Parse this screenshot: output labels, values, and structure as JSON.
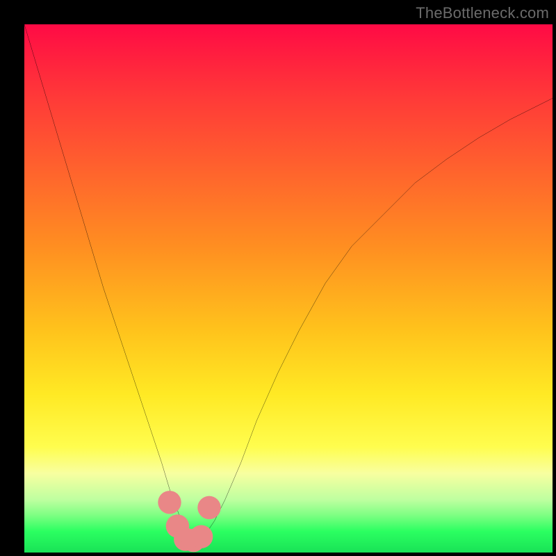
{
  "attribution": "TheBottleneck.com",
  "chart_data": {
    "type": "line",
    "title": "",
    "xlabel": "",
    "ylabel": "",
    "xlim": [
      0,
      100
    ],
    "ylim": [
      0,
      100
    ],
    "grid": false,
    "series": [
      {
        "name": "curve",
        "color": "#000000",
        "x": [
          0,
          3,
          6,
          9,
          12,
          15,
          18,
          20,
          22,
          24,
          26,
          27.5,
          29,
          30,
          31,
          32,
          33,
          34,
          36,
          38,
          41,
          44,
          48,
          52,
          57,
          62,
          68,
          74,
          80,
          86,
          92,
          100
        ],
        "y": [
          100,
          90,
          80,
          70,
          60,
          50,
          41,
          35,
          29,
          23,
          17,
          12,
          8,
          5,
          3,
          2.1,
          2.3,
          3,
          6,
          10,
          17,
          25,
          34,
          42,
          51,
          58,
          64,
          70,
          74.5,
          78.5,
          82,
          86
        ]
      }
    ],
    "markers": [
      {
        "name": "marker-1",
        "x": 27.5,
        "y": 9.5,
        "color": "#e98787",
        "r": 2.2
      },
      {
        "name": "marker-2",
        "x": 29,
        "y": 5.0,
        "color": "#e98787",
        "r": 2.2
      },
      {
        "name": "marker-3",
        "x": 30.5,
        "y": 2.5,
        "color": "#e98787",
        "r": 2.2
      },
      {
        "name": "marker-4",
        "x": 32.0,
        "y": 2.3,
        "color": "#e98787",
        "r": 2.2
      },
      {
        "name": "marker-5",
        "x": 33.5,
        "y": 3.0,
        "color": "#e98787",
        "r": 2.2
      },
      {
        "name": "marker-6",
        "x": 35.0,
        "y": 8.5,
        "color": "#e98787",
        "r": 2.2
      }
    ]
  }
}
